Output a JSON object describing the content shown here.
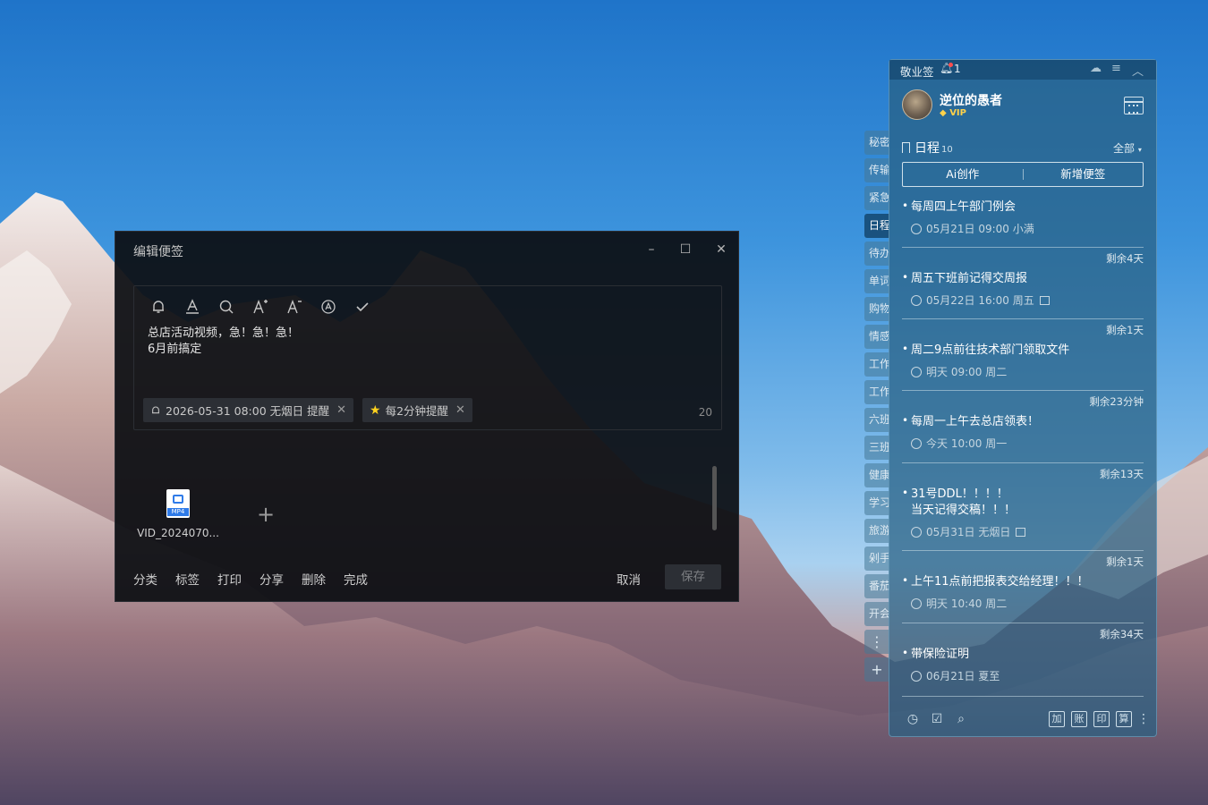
{
  "editor": {
    "title": "编辑便签",
    "content_line1": "总店活动视频，急！急！急！",
    "content_line2": "6月前搞定",
    "toolbar_icons": [
      "bell-icon",
      "text-color-icon",
      "search-icon",
      "font-increase-icon",
      "font-decrease-icon",
      "format-clear-icon",
      "check-icon"
    ],
    "reminder_chip": "2026-05-31 08:00 无烟日 提醒",
    "repeat_chip": "每2分钟提醒",
    "char_count": "20",
    "attachment_name": "VID_2024070...",
    "attachment_type": "MP4",
    "bottom_links": [
      "分类",
      "标签",
      "打印",
      "分享",
      "删除",
      "完成"
    ],
    "cancel_label": "取消",
    "save_label": "保存"
  },
  "side_tabs": [
    "秘密",
    "传输",
    "紧急",
    "日程",
    "待办",
    "单词",
    "购物",
    "情感",
    "工作",
    "工作",
    "六班",
    "三班",
    "健康",
    "学习",
    "旅游",
    "剁手",
    "番茄",
    "开会"
  ],
  "panel": {
    "app_name": "敬业签",
    "notification_count": "1",
    "username": "逆位的愚者",
    "vip_label": "VIP",
    "section_title": "日程",
    "section_count": "10",
    "filter_label": "全部",
    "ai_create_label": "Ai创作",
    "new_note_label": "新增便签",
    "items": [
      {
        "remain": "",
        "title": "每周四上午部门例会",
        "title2": "",
        "meta": "05月21日 09:00 小满"
      },
      {
        "remain": "剩余4天",
        "title": "周五下班前记得交周报",
        "title2": "",
        "meta": "05月22日 16:00 周五"
      },
      {
        "remain": "剩余1天",
        "title": "周二9点前往技术部门领取文件",
        "title2": "",
        "meta": "明天 09:00 周二"
      },
      {
        "remain": "剩余23分钟",
        "title": "每周一上午去总店领表！",
        "title2": "",
        "meta": "今天 10:00 周一"
      },
      {
        "remain": "剩余13天",
        "title": "31号DDL！！！！",
        "title2": "当天记得交稿！！！",
        "meta": "05月31日 无烟日"
      },
      {
        "remain": "剩余1天",
        "title": "上午11点前把报表交给经理！！！",
        "title2": "",
        "meta": "明天 10:40 周二"
      },
      {
        "remain": "剩余34天",
        "title": "带保险证明",
        "title2": "",
        "meta": "06月21日 夏至"
      }
    ],
    "bottom_tools": [
      "加",
      "账",
      "印",
      "算"
    ]
  },
  "colors": {
    "accent_vip": "#ffd24a",
    "notification_dot": "#ff4d4d",
    "attachment_blue": "#2f7be8"
  }
}
